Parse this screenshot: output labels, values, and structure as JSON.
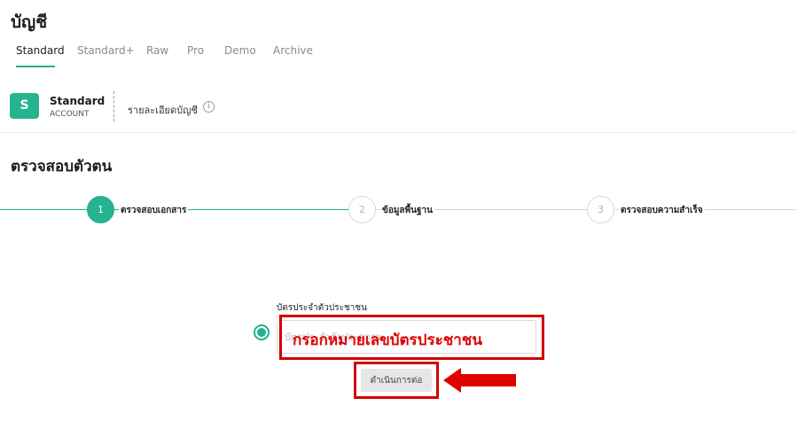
{
  "page": {
    "title": "บัญชี"
  },
  "tabs": [
    {
      "label": "Standard",
      "active": true
    },
    {
      "label": "Standard+",
      "active": false
    },
    {
      "label": "Raw",
      "active": false
    },
    {
      "label": "Pro",
      "active": false
    },
    {
      "label": "Demo",
      "active": false
    },
    {
      "label": "Archive",
      "active": false
    }
  ],
  "account": {
    "avatar_letter": "S",
    "name": "Standard",
    "type": "ACCOUNT",
    "detail_link": "รายละเอียดบัญชี",
    "info_icon_glyph": "i"
  },
  "verification": {
    "title": "ตรวจสอบตัวตน",
    "steps": [
      {
        "number": "1",
        "label": "ตรวจสอบเอกสาร",
        "status": "active"
      },
      {
        "number": "2",
        "label": "ข้อมูลพื้นฐาน",
        "status": "pending"
      },
      {
        "number": "3",
        "label": "ตรวจสอบความสำเร็จ",
        "status": "pending"
      }
    ]
  },
  "form": {
    "id_card_label": "บัตรประจำตัวประชาชน",
    "id_card_placeholder": "บัตรประจำตัวประชาชน",
    "id_card_value": "",
    "continue_label": "ดำเนินการต่อ"
  },
  "annotation": {
    "text": "กรอกหมายเลขบัตรประชาชน",
    "color": "#d20000"
  },
  "colors": {
    "accent": "#1fb28e",
    "avatar": "#24b48f"
  }
}
